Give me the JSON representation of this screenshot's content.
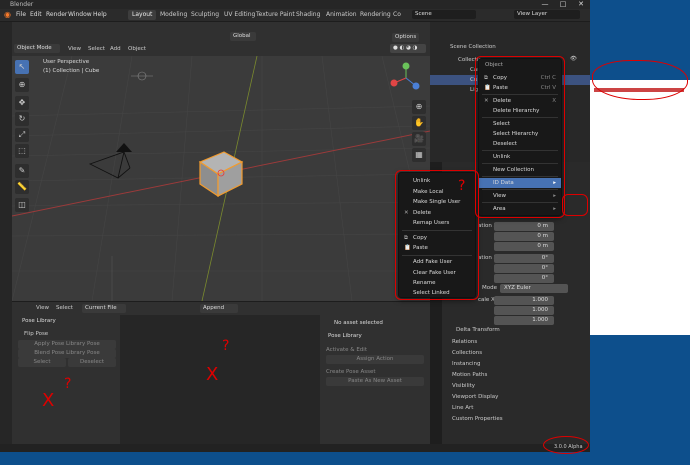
{
  "window": {
    "title": "Blender",
    "controls": [
      "—",
      "□",
      "✕"
    ]
  },
  "topbar": {
    "menus": [
      "File",
      "Edit",
      "Render",
      "Window",
      "Help"
    ],
    "workspaces": [
      "Layout",
      "Modeling",
      "Sculpting",
      "UV Editing",
      "Texture Paint",
      "Shading",
      "Animation",
      "Rendering",
      "Co"
    ],
    "scene": "Scene",
    "view_layer": "View Layer"
  },
  "viewport_header": {
    "mode": "Object Mode",
    "menus": [
      "View",
      "Select",
      "Add",
      "Object"
    ],
    "transform": "Global",
    "options": "Options"
  },
  "viewport": {
    "perspective": "User Perspective",
    "collection": "(1) Collection | Cube"
  },
  "outliner": {
    "header": "Scene Collection",
    "rows": [
      "Collection",
      "Cam",
      "Cu",
      "Light"
    ]
  },
  "object_menu": {
    "title": "Object",
    "items": [
      {
        "label": "Copy",
        "shortcut": "Ctrl C"
      },
      {
        "label": "Paste",
        "shortcut": "Ctrl V"
      },
      {
        "label": "Delete",
        "shortcut": "X"
      },
      {
        "label": "Delete Hierarchy",
        "shortcut": ""
      },
      {
        "label": "Select",
        "shortcut": ""
      },
      {
        "label": "Select Hierarchy",
        "shortcut": ""
      },
      {
        "label": "Deselect",
        "shortcut": ""
      },
      {
        "label": "Unlink",
        "shortcut": ""
      },
      {
        "label": "New Collection",
        "shortcut": ""
      },
      {
        "label": "ID Data",
        "shortcut": ""
      },
      {
        "label": "View",
        "shortcut": ""
      },
      {
        "label": "Area",
        "shortcut": ""
      }
    ]
  },
  "id_menu": {
    "items": [
      "Unlink",
      "Make Local",
      "Make Single User",
      "Delete",
      "Remap Users",
      "Copy",
      "Paste",
      "Add Fake User",
      "Clear Fake User",
      "Rename",
      "Select Linked"
    ]
  },
  "properties": {
    "location": {
      "label": "ation X",
      "x": "0 m",
      "y": "0 m",
      "z": "0 m"
    },
    "rotation": {
      "label": "ation X",
      "x": "0°",
      "y": "0°",
      "z": "0°"
    },
    "mode": {
      "label": "Mode",
      "value": "XYZ Euler"
    },
    "scale": {
      "label": "cale X",
      "x": "1.000",
      "y": "1.000",
      "z": "1.000"
    },
    "sections": [
      "Delta Transform",
      "Relations",
      "Collections",
      "Instancing",
      "Motion Paths",
      "Visibility",
      "Viewport Display",
      "Line Art",
      "Custom Properties"
    ]
  },
  "bottom_header": {
    "menus": [
      "View",
      "Select"
    ],
    "current_file": "Current File",
    "append": "Append"
  },
  "pose_library": {
    "title": "Pose Library",
    "flip": "Flip Pose",
    "apply": "Apply Pose Library Pose",
    "blend": "Blend Pose Library Pose",
    "select": "Select",
    "deselect": "Deselect"
  },
  "asset_panel": {
    "status": "No asset selected",
    "title": "Pose Library",
    "activate": "Activate & Edit",
    "assign": "Assign Action",
    "create": "Create Pose Asset",
    "paste": "Paste As New Asset"
  },
  "statusbar": {
    "version": "3.0.0 Alpha"
  },
  "annotations": {
    "q": "?",
    "x": "X"
  },
  "accent": "#4772b3"
}
